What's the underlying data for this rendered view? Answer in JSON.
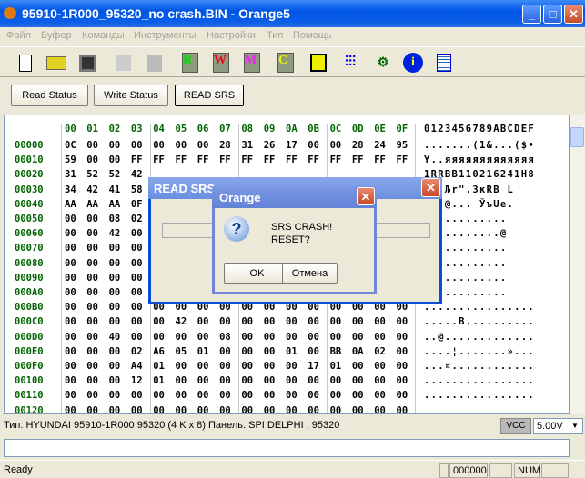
{
  "window": {
    "title": "95910-1R000_95320_no crash.BIN - Orange5",
    "min": "_",
    "max": "□",
    "close": "✕"
  },
  "menu": [
    "Файл",
    "Буфер",
    "Команды",
    "Инструменты",
    "Настройки",
    "Тип",
    "Помощь"
  ],
  "toolbar": {
    "chips": [
      "R",
      "W",
      "M",
      "C"
    ]
  },
  "buttons": {
    "read_status": "Read Status",
    "write_status": "Write Status",
    "read_srs": "READ  SRS"
  },
  "hex": {
    "header": [
      "00",
      "01",
      "02",
      "03",
      "04",
      "05",
      "06",
      "07",
      "08",
      "09",
      "0A",
      "0B",
      "0C",
      "0D",
      "0E",
      "0F"
    ],
    "ascii_header": "0123456789ABCDEF",
    "rows": [
      {
        "addr": "00000",
        "bytes": [
          "0C",
          "00",
          "00",
          "00",
          "00",
          "00",
          "00",
          "28",
          "31",
          "26",
          "17",
          "00",
          "00",
          "28",
          "24",
          "95"
        ],
        "ascii": ".......(1&...($•"
      },
      {
        "addr": "00010",
        "bytes": [
          "59",
          "00",
          "00",
          "FF",
          "FF",
          "FF",
          "FF",
          "FF",
          "FF",
          "FF",
          "FF",
          "FF",
          "FF",
          "FF",
          "FF",
          "FF"
        ],
        "ascii": "Y..яяяяяяяяяяяяя"
      },
      {
        "addr": "00020",
        "bytes": [
          "31",
          "52",
          "52",
          "42"
        ],
        "ascii": "1RRBB110216241H8"
      },
      {
        "addr": "00030",
        "bytes": [
          "34",
          "42",
          "41",
          "58"
        ],
        "ascii": "X&.Љr\".ЗкRB L"
      },
      {
        "addr": "00040",
        "bytes": [
          "AA",
          "AA",
          "AA",
          "0F"
        ],
        "ascii": "...@... ЎъUe."
      },
      {
        "addr": "00050",
        "bytes": [
          "00",
          "00",
          "08",
          "02"
        ],
        "ascii": "............"
      },
      {
        "addr": "00060",
        "bytes": [
          "00",
          "00",
          "42",
          "00"
        ],
        "ascii": "...........@"
      },
      {
        "addr": "00070",
        "bytes": [
          "00",
          "00",
          "00",
          "00"
        ],
        "ascii": "............"
      },
      {
        "addr": "00080",
        "bytes": [
          "00",
          "00",
          "00",
          "00"
        ],
        "ascii": "............"
      },
      {
        "addr": "00090",
        "bytes": [
          "00",
          "00",
          "00",
          "00"
        ],
        "ascii": "............"
      },
      {
        "addr": "000A0",
        "bytes": [
          "00",
          "00",
          "00",
          "00"
        ],
        "ascii": "............"
      },
      {
        "addr": "000B0",
        "bytes": [
          "00",
          "00",
          "00",
          "00",
          "00",
          "00",
          "00",
          "00",
          "00",
          "00",
          "00",
          "00",
          "00",
          "00",
          "00",
          "00"
        ],
        "ascii": "................"
      },
      {
        "addr": "000C0",
        "bytes": [
          "00",
          "00",
          "00",
          "00",
          "00",
          "42",
          "00",
          "00",
          "00",
          "00",
          "00",
          "00",
          "00",
          "00",
          "00",
          "00"
        ],
        "ascii": ".....B.........."
      },
      {
        "addr": "000D0",
        "bytes": [
          "00",
          "00",
          "40",
          "00",
          "00",
          "00",
          "00",
          "08",
          "00",
          "00",
          "00",
          "00",
          "00",
          "00",
          "00",
          "00"
        ],
        "ascii": "..@............."
      },
      {
        "addr": "000E0",
        "bytes": [
          "00",
          "00",
          "00",
          "02",
          "A6",
          "05",
          "01",
          "00",
          "00",
          "00",
          "01",
          "00",
          "BB",
          "0A",
          "02",
          "00"
        ],
        "ascii": "....¦.......»..."
      },
      {
        "addr": "000F0",
        "bytes": [
          "00",
          "00",
          "00",
          "A4",
          "01",
          "00",
          "00",
          "00",
          "00",
          "00",
          "00",
          "17",
          "01",
          "00",
          "00",
          "00"
        ],
        "ascii": "...¤............"
      },
      {
        "addr": "00100",
        "bytes": [
          "00",
          "00",
          "00",
          "12",
          "01",
          "00",
          "00",
          "00",
          "00",
          "00",
          "00",
          "00",
          "00",
          "00",
          "00",
          "00"
        ],
        "ascii": "................"
      },
      {
        "addr": "00110",
        "bytes": [
          "00",
          "00",
          "00",
          "00",
          "00",
          "00",
          "00",
          "00",
          "00",
          "00",
          "00",
          "00",
          "00",
          "00",
          "00",
          "00"
        ],
        "ascii": "................"
      },
      {
        "addr": "00120",
        "bytes": [
          "00",
          "00",
          "00",
          "00",
          "00",
          "00",
          "00",
          "00",
          "00",
          "00",
          "00",
          "00",
          "00",
          "00",
          "00",
          "00"
        ],
        "ascii": ""
      }
    ]
  },
  "info": {
    "text": "Тип: HYUNDAI 95910-1R000    95320 (4 K x 8)  Панель: SPI    DELPHI , 95320",
    "vcc": "VCC",
    "voltage": "5.00V"
  },
  "status": {
    "text": "Ready",
    "offset": "000000",
    "num": "NUM"
  },
  "read_srs_dialog": {
    "title": "READ  SRS",
    "close": "✕"
  },
  "message_box": {
    "title": "Orange",
    "close": "✕",
    "line1": "SRS CRASH!",
    "line2": "RESET?",
    "ok": "OK",
    "cancel": "Отмена"
  }
}
